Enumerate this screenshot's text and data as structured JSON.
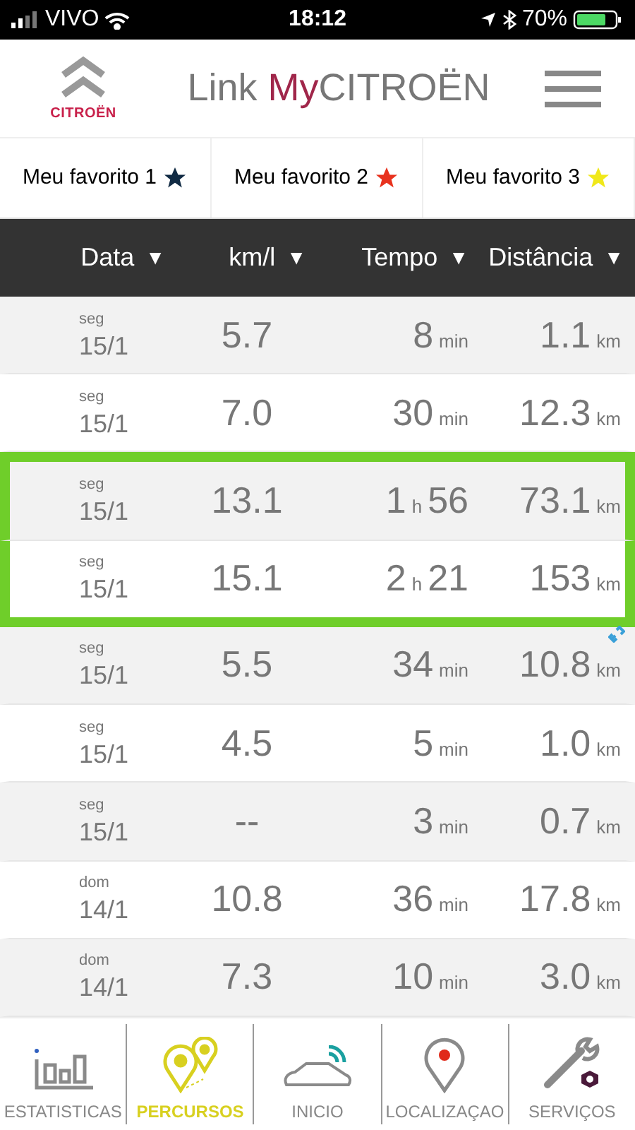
{
  "status_bar": {
    "carrier": "VIVO",
    "time": "18:12",
    "battery": "70%"
  },
  "header": {
    "logo_text": "CITROËN",
    "title_prefix": "Link ",
    "title_my": "My",
    "title_brand": "CITROËN"
  },
  "favorites": [
    {
      "label": "Meu favorito 1",
      "color": "#102a43"
    },
    {
      "label": "Meu favorito 2",
      "color": "#e8321e"
    },
    {
      "label": "Meu favorito 3",
      "color": "#f0e81a"
    }
  ],
  "table": {
    "columns": [
      {
        "label": "Data",
        "arrow": "▼"
      },
      {
        "label": "km/l",
        "arrow": "▼"
      },
      {
        "label": "Tempo",
        "arrow": "▼"
      },
      {
        "label": "Distância",
        "arrow": "▼"
      }
    ],
    "rows": [
      {
        "day": "seg",
        "date": "15/1",
        "kml": "5.7",
        "time": [
          {
            "text": "8",
            "kind": "number"
          },
          {
            "text": "min",
            "kind": "unit"
          }
        ],
        "distance": "1.1",
        "distance_unit": "km",
        "highlighted": false,
        "linked": false
      },
      {
        "day": "seg",
        "date": "15/1",
        "kml": "7.0",
        "time": [
          {
            "text": "30",
            "kind": "number"
          },
          {
            "text": "min",
            "kind": "unit"
          }
        ],
        "distance": "12.3",
        "distance_unit": "km",
        "highlighted": false,
        "linked": false
      },
      {
        "day": "seg",
        "date": "15/1",
        "kml": "13.1",
        "time": [
          {
            "text": "1",
            "kind": "number"
          },
          {
            "text": "h",
            "kind": "unit"
          },
          {
            "text": "56",
            "kind": "number"
          }
        ],
        "distance": "73.1",
        "distance_unit": "km",
        "highlighted": true,
        "linked": false
      },
      {
        "day": "seg",
        "date": "15/1",
        "kml": "15.1",
        "time": [
          {
            "text": "2",
            "kind": "number"
          },
          {
            "text": "h",
            "kind": "unit"
          },
          {
            "text": "21",
            "kind": "number"
          }
        ],
        "distance": "153",
        "distance_unit": "km",
        "highlighted": true,
        "linked": false
      },
      {
        "day": "seg",
        "date": "15/1",
        "kml": "5.5",
        "time": [
          {
            "text": "34",
            "kind": "number"
          },
          {
            "text": "min",
            "kind": "unit"
          }
        ],
        "distance": "10.8",
        "distance_unit": "km",
        "highlighted": false,
        "linked": true
      },
      {
        "day": "seg",
        "date": "15/1",
        "kml": "4.5",
        "time": [
          {
            "text": "5",
            "kind": "number"
          },
          {
            "text": "min",
            "kind": "unit"
          }
        ],
        "distance": "1.0",
        "distance_unit": "km",
        "highlighted": false,
        "linked": false
      },
      {
        "day": "seg",
        "date": "15/1",
        "kml": "--",
        "time": [
          {
            "text": "3",
            "kind": "number"
          },
          {
            "text": "min",
            "kind": "unit"
          }
        ],
        "distance": "0.7",
        "distance_unit": "km",
        "highlighted": false,
        "linked": false
      },
      {
        "day": "dom",
        "date": "14/1",
        "kml": "10.8",
        "time": [
          {
            "text": "36",
            "kind": "number"
          },
          {
            "text": "min",
            "kind": "unit"
          }
        ],
        "distance": "17.8",
        "distance_unit": "km",
        "highlighted": false,
        "linked": false
      },
      {
        "day": "dom",
        "date": "14/1",
        "kml": "7.3",
        "time": [
          {
            "text": "10",
            "kind": "number"
          },
          {
            "text": "min",
            "kind": "unit"
          }
        ],
        "distance": "3.0",
        "distance_unit": "km",
        "highlighted": false,
        "linked": false
      }
    ]
  },
  "tab_bar": [
    {
      "label": "ESTATISTICAS",
      "kind": "stats",
      "selected": false
    },
    {
      "label": "PERCURSOS",
      "kind": "routes",
      "selected": true
    },
    {
      "label": "INICIO",
      "kind": "car",
      "selected": false
    },
    {
      "label": "LOCALIZAÇAO",
      "kind": "location",
      "selected": false
    },
    {
      "label": "SERVIÇOS",
      "kind": "services",
      "selected": false
    }
  ]
}
